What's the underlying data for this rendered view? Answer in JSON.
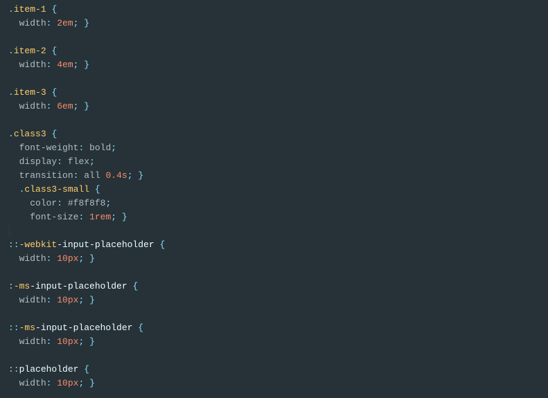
{
  "code": {
    "rules": [
      {
        "selector_parts": [
          ".",
          "item-1"
        ],
        "declarations": [
          {
            "prop": "width",
            "value": "2em",
            "valueType": "number"
          }
        ],
        "indent": 0
      },
      {
        "selector_parts": [
          ".",
          "item-2"
        ],
        "declarations": [
          {
            "prop": "width",
            "value": "4em",
            "valueType": "number"
          }
        ],
        "indent": 0
      },
      {
        "selector_parts": [
          ".",
          "item-3"
        ],
        "declarations": [
          {
            "prop": "width",
            "value": "6em",
            "valueType": "number"
          }
        ],
        "indent": 0
      },
      {
        "selector_parts": [
          ".",
          "class3"
        ],
        "declarations": [
          {
            "prop": "font-weight",
            "value": "bold",
            "valueType": "keyword"
          },
          {
            "prop": "display",
            "value": "flex",
            "valueType": "keyword"
          },
          {
            "prop": "transition",
            "value_parts": [
              {
                "t": "all",
                "k": "keyword"
              },
              {
                "t": " ",
                "k": "space"
              },
              {
                "t": "0.4s",
                "k": "number"
              }
            ]
          }
        ],
        "indent": 0,
        "noTrailingBlank": true
      },
      {
        "selector_parts": [
          ".",
          "class3-small"
        ],
        "declarations": [
          {
            "prop": "color",
            "value": "#f8f8f8",
            "valueType": "hex"
          },
          {
            "prop": "font-size",
            "value": "1rem",
            "valueType": "number"
          }
        ],
        "indent": 1,
        "caretAfter": true
      },
      {
        "selector_parts": [
          "::",
          "-webkit",
          "-input-placeholder"
        ],
        "selectorStyle": "pseudo",
        "declarations": [
          {
            "prop": "width",
            "value": "10px",
            "valueType": "number"
          }
        ],
        "indent": 0
      },
      {
        "selector_parts": [
          ":",
          "-ms",
          "-input-placeholder"
        ],
        "selectorStyle": "pseudo",
        "declarations": [
          {
            "prop": "width",
            "value": "10px",
            "valueType": "number"
          }
        ],
        "indent": 0
      },
      {
        "selector_parts": [
          "::",
          "-ms",
          "-input-placeholder"
        ],
        "selectorStyle": "pseudo",
        "declarations": [
          {
            "prop": "width",
            "value": "10px",
            "valueType": "number"
          }
        ],
        "indent": 0
      },
      {
        "selector_parts": [
          "::",
          "placeholder"
        ],
        "selectorStyle": "pseudo-simple",
        "declarations": [
          {
            "prop": "width",
            "value": "10px",
            "valueType": "number"
          }
        ],
        "indent": 0
      }
    ]
  }
}
